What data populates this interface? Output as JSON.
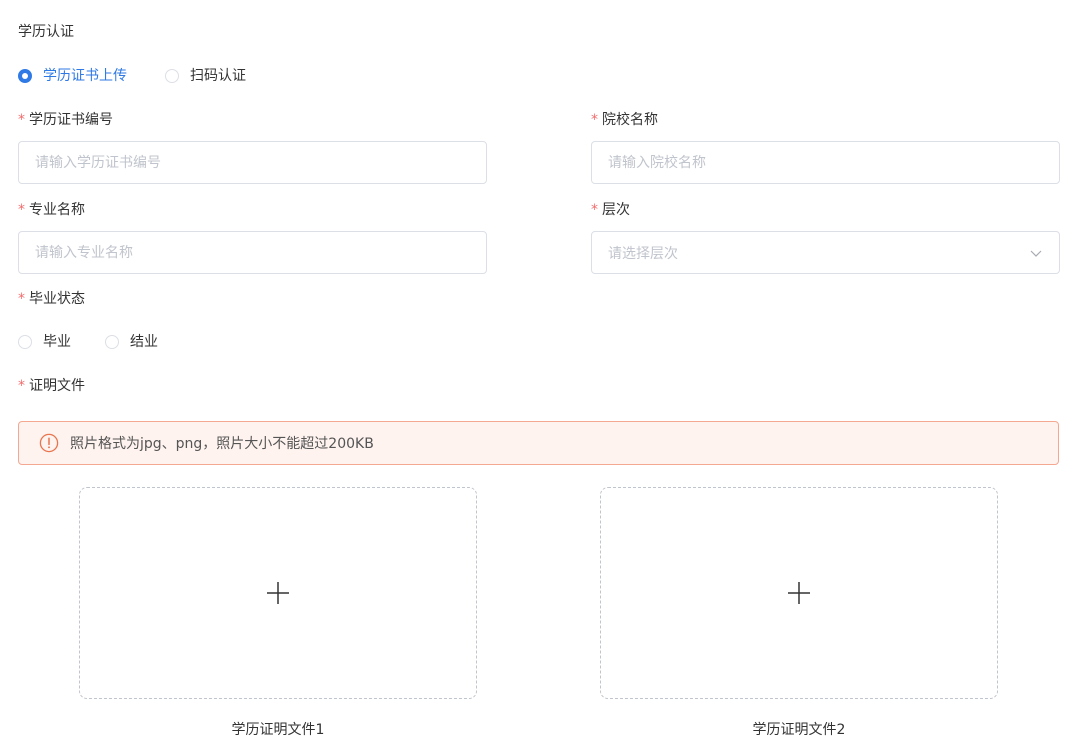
{
  "section": {
    "title": "学历认证"
  },
  "auth_method": {
    "options": [
      {
        "label": "学历证书上传",
        "selected": true
      },
      {
        "label": "扫码认证",
        "selected": false
      }
    ]
  },
  "form": {
    "required_mark": "*",
    "certificate_no": {
      "label": "学历证书编号",
      "placeholder": "请输入学历证书编号",
      "value": ""
    },
    "school_name": {
      "label": "院校名称",
      "placeholder": "请输入院校名称",
      "value": ""
    },
    "major_name": {
      "label": "专业名称",
      "placeholder": "请输入专业名称",
      "value": ""
    },
    "level": {
      "label": "层次",
      "placeholder": "请选择层次",
      "icon": "chevron-down-icon"
    },
    "graduation_status": {
      "label": "毕业状态",
      "options": [
        {
          "label": "毕业",
          "selected": false
        },
        {
          "label": "结业",
          "selected": false
        }
      ]
    },
    "proof_files": {
      "label": "证明文件",
      "notice": "照片格式为jpg、png，照片大小不能超过200KB",
      "notice_icon": "exclamation-circle-icon",
      "uploads": [
        {
          "caption": "学历证明文件1",
          "icon": "plus-icon"
        },
        {
          "caption": "学历证明文件2",
          "icon": "plus-icon"
        }
      ]
    }
  },
  "colors": {
    "primary": "#2f7ae5",
    "required": "#f56c6c",
    "border": "#dcdfe6",
    "placeholder": "#c0c4cc",
    "alert_border": "#f4a892",
    "alert_bg": "#fef3ef",
    "alert_icon": "#e8754f"
  }
}
